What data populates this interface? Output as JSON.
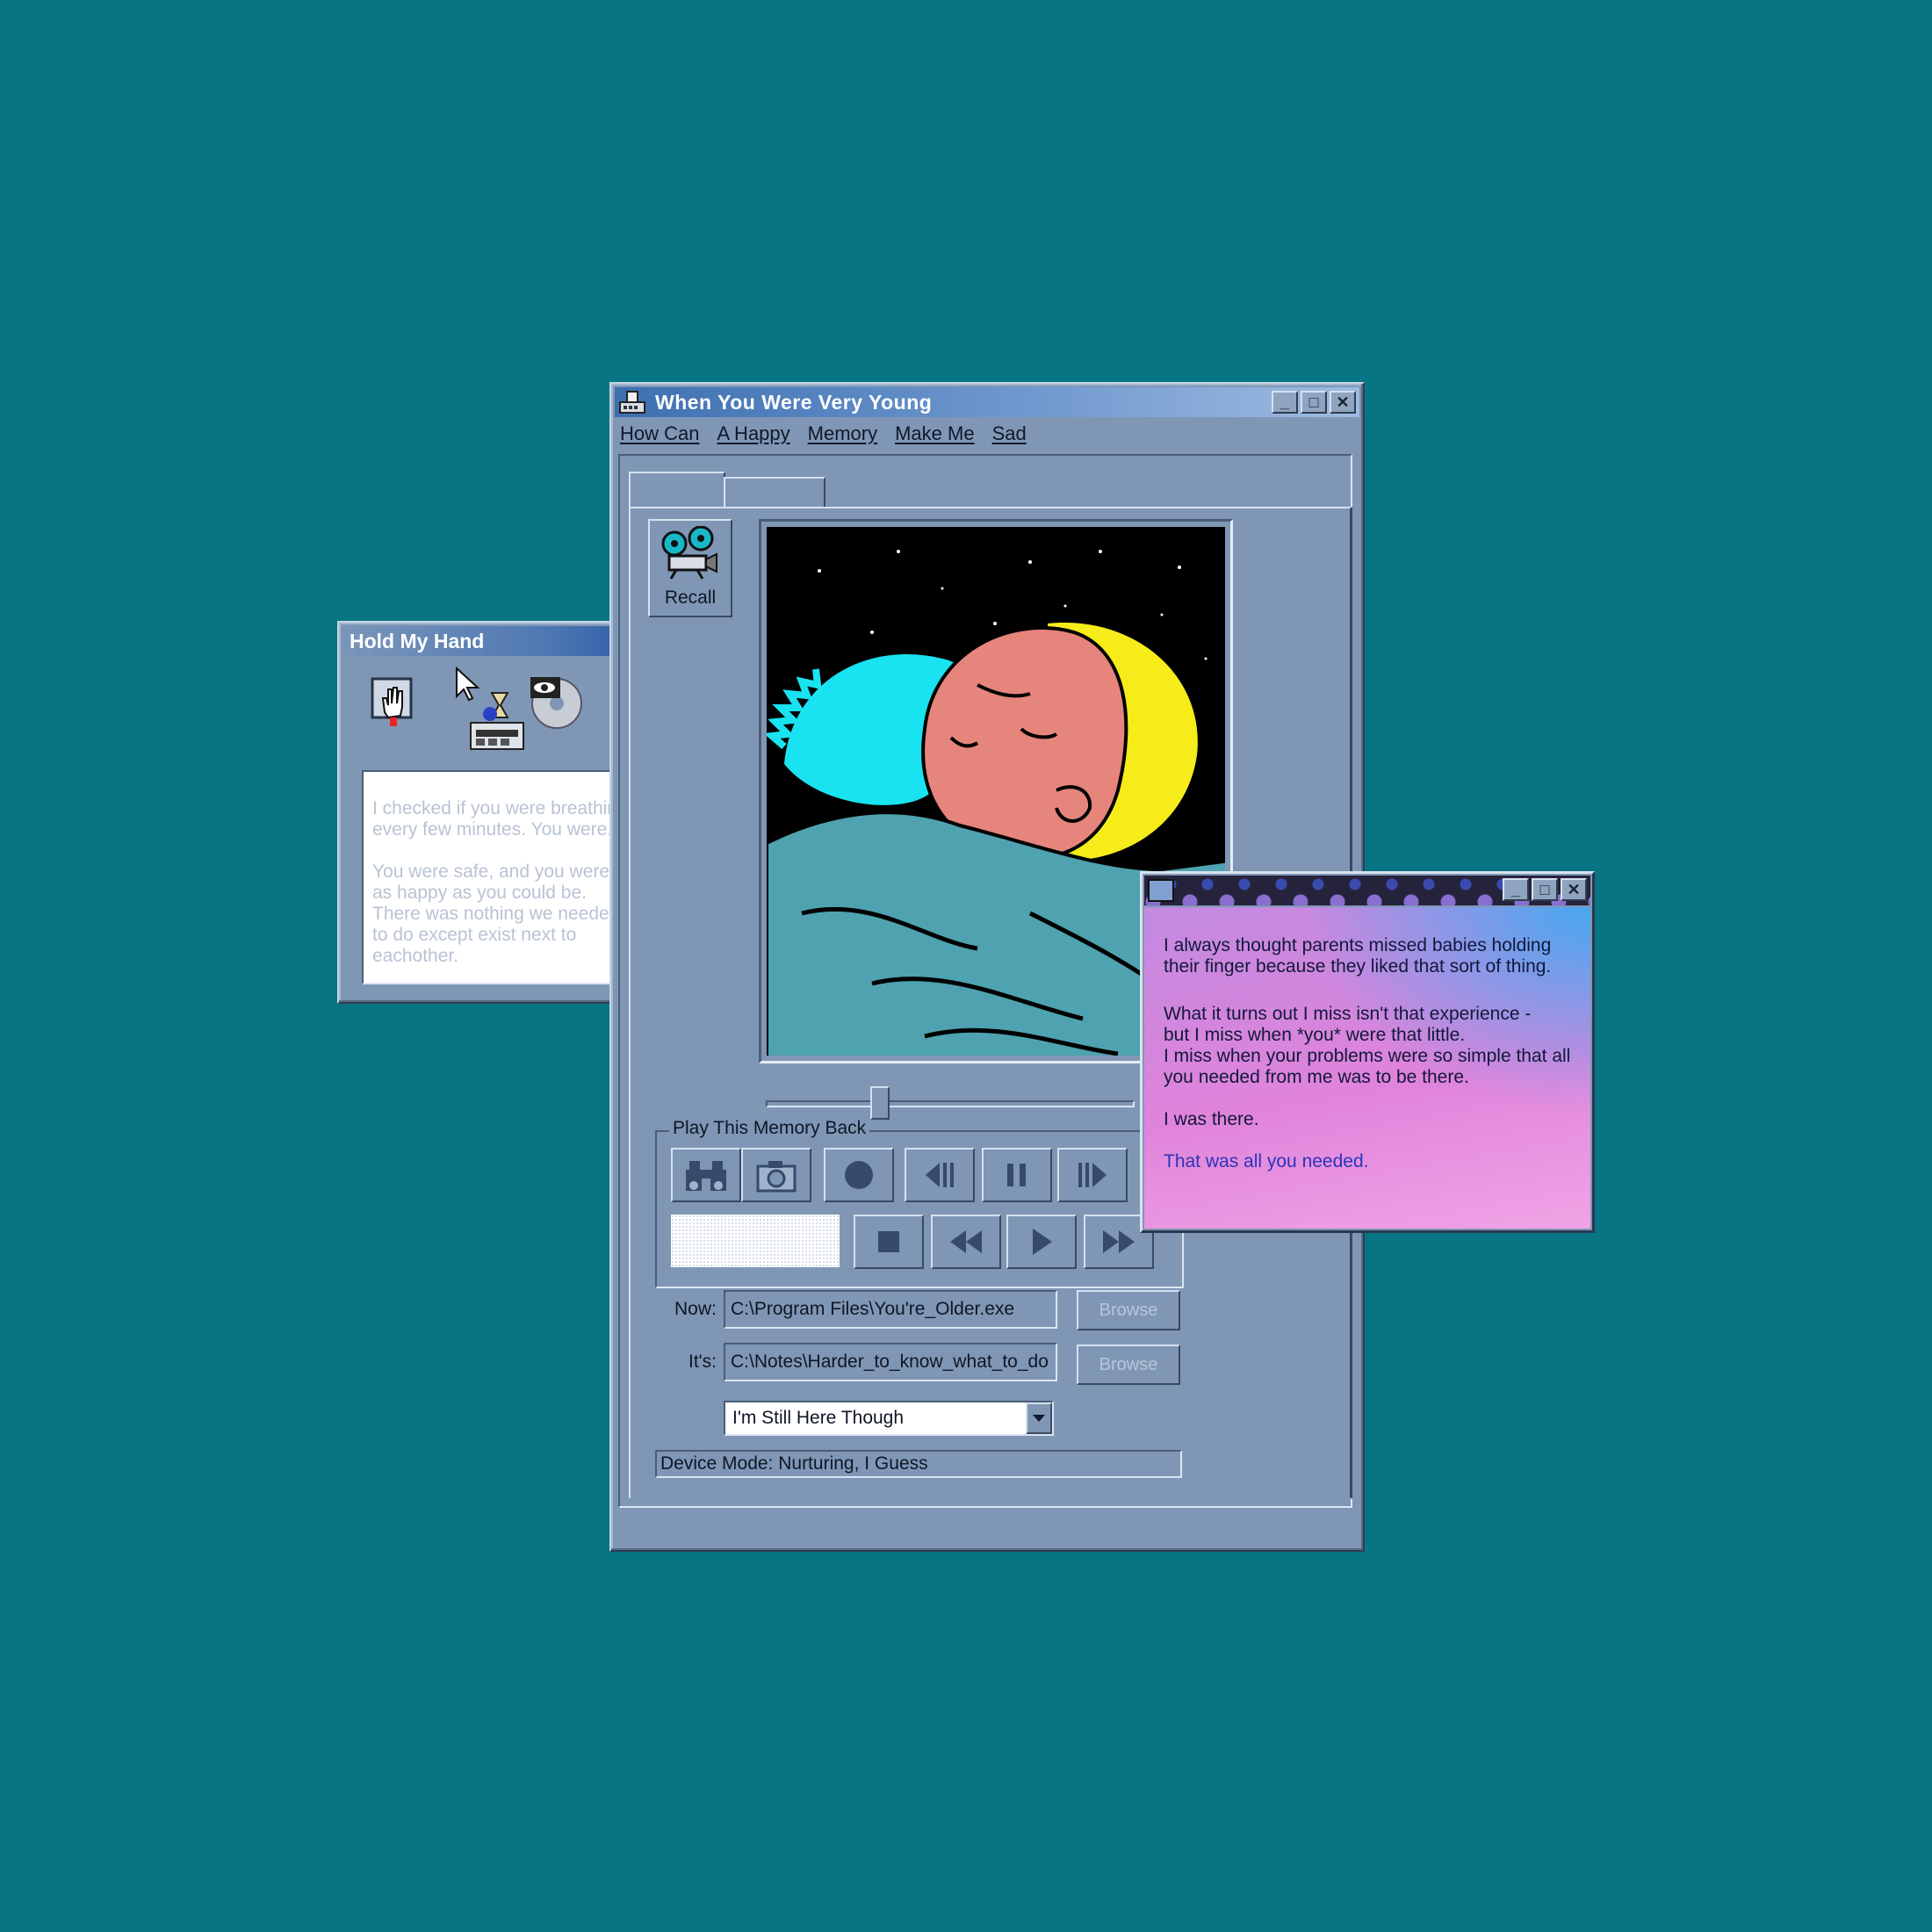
{
  "hold_window": {
    "title": "Hold My Hand",
    "text_p1": "I checked if you were breathing every few minutes. You were.",
    "text_p2": "You were safe, and you were as happy as you could be. There was nothing we needed to do except exist next to eachother."
  },
  "main_window": {
    "title": "When You Were Very Young",
    "menu": [
      "How Can",
      "A Happy",
      "Memory",
      "Make Me",
      "Sad"
    ],
    "recall_label": "Recall",
    "groupbox_label": "Play This Memory Back",
    "now_label": "Now:",
    "now_value": "C:\\Program Files\\You're_Older.exe",
    "its_label": "It's:",
    "its_value": "C:\\Notes\\Harder_to_know_what_to_do",
    "browse_label": "Browse",
    "dropdown_value": "I'm Still Here Though",
    "status": "Device Mode: Nurturing, I Guess",
    "slider_position": 0.3
  },
  "note_window": {
    "p1": "I always thought parents missed babies holding their finger because they liked that sort of thing.",
    "p2a": "What it turns out I miss isn't that experience -",
    "p2b": "but I miss when *you* were that little.",
    "p2c": "I miss when your problems were so simple that all you needed from me was to be there.",
    "p3": "I was there.",
    "p4": "That was all you needed."
  }
}
